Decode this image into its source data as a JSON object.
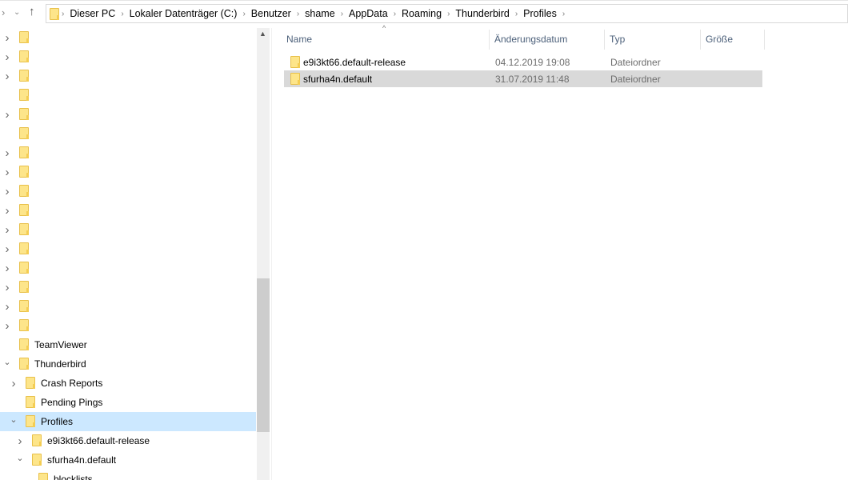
{
  "address": {
    "crumbs": [
      "Dieser PC",
      "Lokaler Datenträger (C:)",
      "Benutzer",
      "shame",
      "AppData",
      "Roaming",
      "Thunderbird",
      "Profiles"
    ]
  },
  "tree": {
    "unnamed_rows": [
      {
        "chevron": true
      },
      {
        "chevron": true
      },
      {
        "chevron": true
      },
      {
        "chevron": false
      },
      {
        "chevron": true
      },
      {
        "chevron": false
      },
      {
        "chevron": true
      },
      {
        "chevron": true
      },
      {
        "chevron": true
      },
      {
        "chevron": true
      },
      {
        "chevron": true
      },
      {
        "chevron": true
      },
      {
        "chevron": true
      },
      {
        "chevron": true
      },
      {
        "chevron": true
      },
      {
        "chevron": true
      }
    ],
    "items": [
      {
        "label": "TeamViewer",
        "level": 0,
        "chevron": "none"
      },
      {
        "label": "Thunderbird",
        "level": 0,
        "chevron": "expanded"
      },
      {
        "label": "Crash Reports",
        "level": 1,
        "chevron": "collapsed"
      },
      {
        "label": "Pending Pings",
        "level": 1,
        "chevron": "none"
      },
      {
        "label": "Profiles",
        "level": 1,
        "chevron": "expanded",
        "selected": true
      },
      {
        "label": "e9i3kt66.default-release",
        "level": 2,
        "chevron": "collapsed"
      },
      {
        "label": "sfurha4n.default",
        "level": 2,
        "chevron": "expanded"
      },
      {
        "label": "blocklists",
        "level": 3,
        "chevron": "none"
      }
    ]
  },
  "columns": [
    "Name",
    "Änderungsdatum",
    "Typ",
    "Größe"
  ],
  "files": [
    {
      "name": "e9i3kt66.default-release",
      "date": "04.12.2019 19:08",
      "type": "Dateiordner",
      "size": ""
    },
    {
      "name": "sfurha4n.default",
      "date": "31.07.2019 11:48",
      "type": "Dateiordner",
      "size": "",
      "selected": true
    }
  ]
}
